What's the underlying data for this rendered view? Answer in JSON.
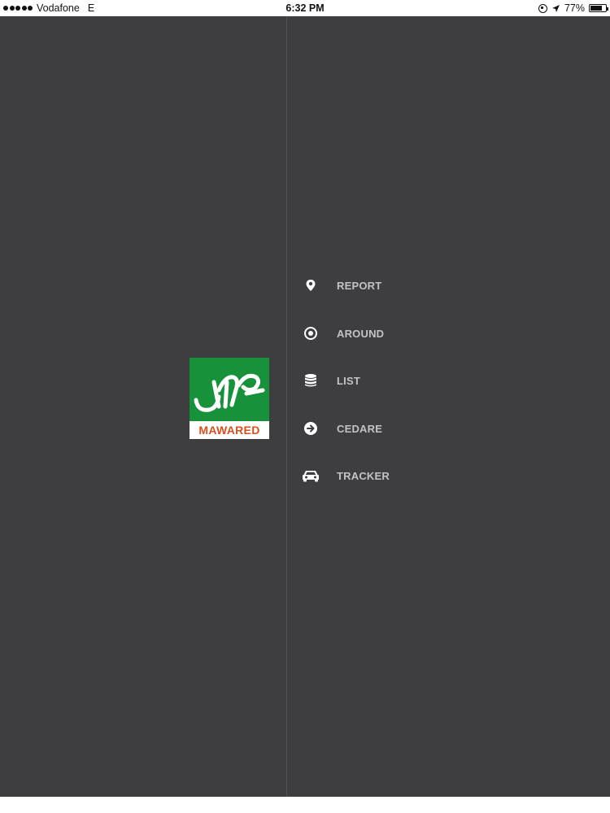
{
  "status_bar": {
    "carrier": "Vodafone",
    "network": "E",
    "time": "6:32 PM",
    "battery_percent": "77%",
    "battery_level": 0.77
  },
  "logo": {
    "text": "MAWARED",
    "brand_green": "#17923a",
    "brand_orange": "#d8501f"
  },
  "menu": {
    "items": [
      {
        "label": "REPORT",
        "icon": "map-pin-icon"
      },
      {
        "label": "AROUND",
        "icon": "target-icon"
      },
      {
        "label": "LIST",
        "icon": "database-icon"
      },
      {
        "label": "CEDARE",
        "icon": "arrow-circle-right-icon"
      },
      {
        "label": "TRACKER",
        "icon": "car-icon"
      }
    ]
  },
  "colors": {
    "background": "#3e3d40",
    "menu_text": "#c3c3c6"
  }
}
